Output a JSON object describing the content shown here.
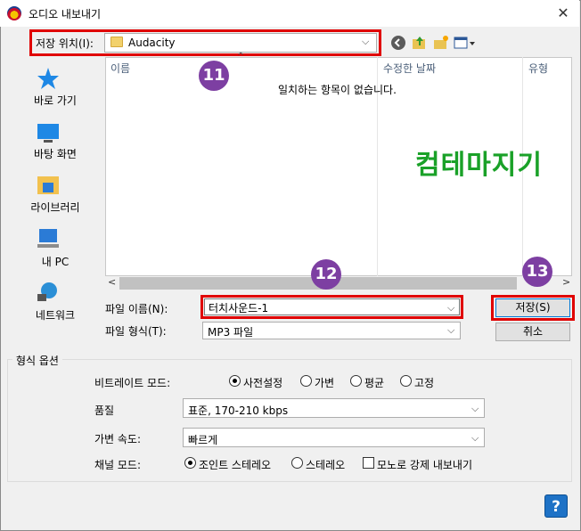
{
  "window": {
    "title": "오디오 내보내기",
    "close_glyph": "✕"
  },
  "location": {
    "label": "저장 위치(I):",
    "value": "Audacity",
    "arrow": "⌵"
  },
  "places": [
    {
      "label": "바로 가기",
      "icon": "star-icon"
    },
    {
      "label": "바탕 화면",
      "icon": "desktop-icon"
    },
    {
      "label": "라이브러리",
      "icon": "library-icon"
    },
    {
      "label": "내 PC",
      "icon": "computer-icon"
    },
    {
      "label": "네트워크",
      "icon": "network-icon"
    }
  ],
  "file_list": {
    "columns": [
      "이름",
      "수정한 날짜",
      "유형"
    ],
    "empty_message": "일치하는 항목이 없습니다.",
    "sort_caret": "^",
    "scroll_left": "<",
    "scroll_right": ">"
  },
  "badges": {
    "b11": "11",
    "b12": "12",
    "b13": "13"
  },
  "file_name": {
    "label": "파일 이름(N):",
    "value": "터치사운드-1",
    "arrow": "⌵"
  },
  "file_type": {
    "label": "파일 형식(T):",
    "value": "MP3 파일",
    "arrow": "⌵"
  },
  "buttons": {
    "save": "저장(S)",
    "cancel": "취소",
    "help": "?"
  },
  "format_options": {
    "title": "형식 옵션",
    "bitrate_mode": {
      "label": "비트레이트 모드:",
      "options": [
        "사전설정",
        "가변",
        "평균",
        "고정"
      ],
      "selected": "사전설정"
    },
    "quality": {
      "label": "품질",
      "value": "표준, 170-210 kbps"
    },
    "variable_speed": {
      "label": "가변 속도:",
      "value": "빠르게"
    },
    "channel_mode": {
      "label": "채널 모드:",
      "options": [
        "조인트 스테레오",
        "스테레오"
      ],
      "selected": "조인트 스테레오",
      "mono_checkbox": "모노로 강제 내보내기",
      "mono_checked": false
    }
  },
  "watermark": "컴테마지기",
  "colors": {
    "highlight": "#e00000",
    "badge": "#7d3fa2",
    "accent": "#0078d7"
  }
}
